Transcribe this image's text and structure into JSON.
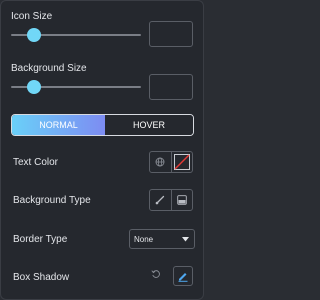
{
  "icon_size": {
    "label": "Icon Size",
    "value": "",
    "level": 0.18
  },
  "background_size": {
    "label": "Background Size",
    "value": "",
    "level": 0.18
  },
  "tabs": {
    "normal": "NORMAL",
    "hover": "HOVER",
    "active": "NORMAL"
  },
  "text_color": {
    "label": "Text Color"
  },
  "background_type": {
    "label": "Background Type"
  },
  "border_type": {
    "label": "Border Type",
    "selected": "None"
  },
  "box_shadow": {
    "label": "Box Shadow"
  },
  "colors": {
    "accent": "#71d7f7",
    "accent_end": "#7d8cf2",
    "edit_icon": "#4fa8f0",
    "clear_red": "#e53935"
  },
  "icons": [
    "globe-icon",
    "no-color-icon",
    "brush-icon",
    "gradient-icon",
    "chevron-down-icon",
    "reset-icon",
    "pencil-icon"
  ]
}
